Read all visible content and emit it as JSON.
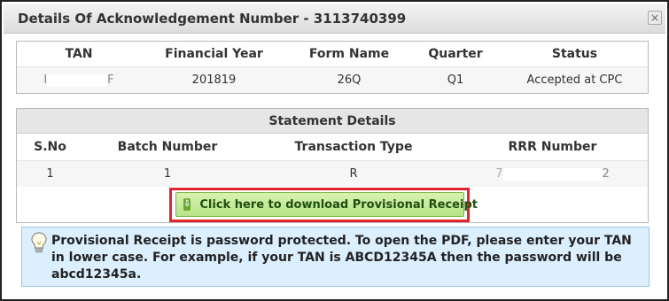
{
  "dialog": {
    "title": "Details Of Acknowledgement Number - 3113740399",
    "close_symbol": "×"
  },
  "summary_table": {
    "headers": [
      "TAN",
      "Financial Year",
      "Form Name",
      "Quarter",
      "Status"
    ],
    "row": {
      "tan_prefix": "I",
      "tan_suffix": "F",
      "financial_year": "201819",
      "form_name": "26Q",
      "quarter": "Q1",
      "status": "Accepted at CPC"
    }
  },
  "statement_details": {
    "title": "Statement Details",
    "headers": [
      "S.No",
      "Batch Number",
      "Transaction Type",
      "RRR Number"
    ],
    "row": {
      "sno": "1",
      "batch_number": "1",
      "transaction_type": "R",
      "rrr_prefix": "7",
      "rrr_suffix": "2"
    }
  },
  "download": {
    "label": "Click here to download Provisional Receipt",
    "icon": "download-arrow-icon",
    "highlight_color": "#e0262c"
  },
  "notice": {
    "icon": "lightbulb-icon",
    "text": "Provisional Receipt is password protected. To open the PDF, please enter your TAN in lower case. For example, if your TAN is ABCD12345A then the password will be abcd12345a."
  }
}
